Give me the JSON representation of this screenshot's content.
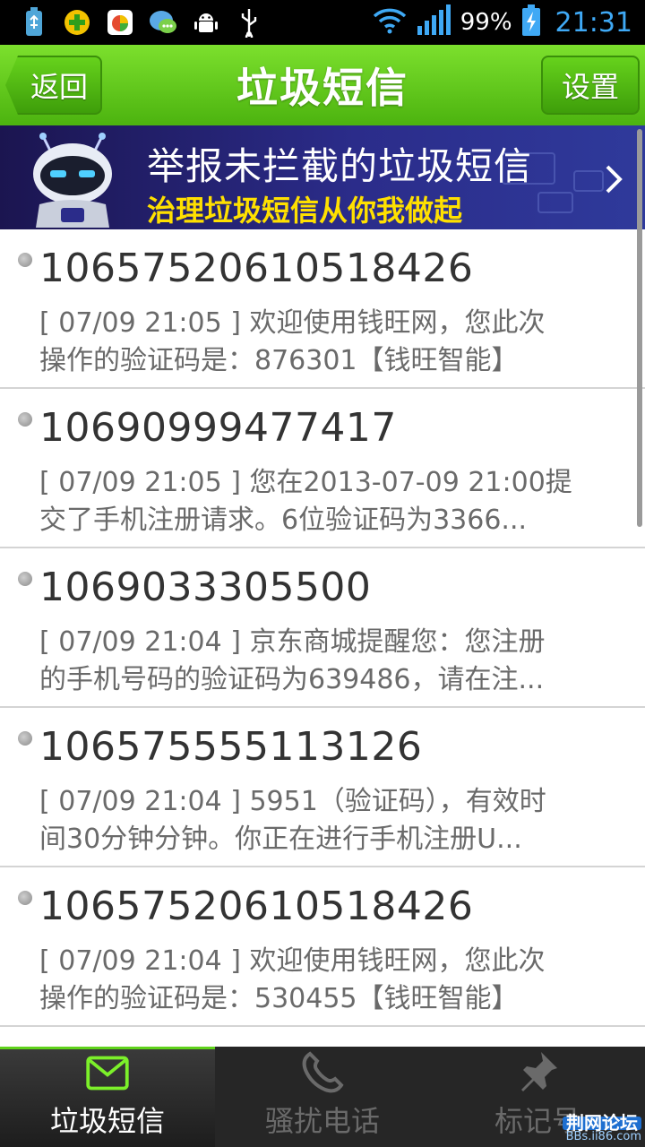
{
  "status_bar": {
    "battery_text": "99%",
    "time": "21:31",
    "icons": [
      "usb-battery-icon",
      "360-security-icon",
      "app-store-icon",
      "chat-qq-icon",
      "android-icon",
      "usb-icon",
      "wifi-icon",
      "signal-icon",
      "battery-charging-icon"
    ],
    "time_color": "#3fa9f5"
  },
  "header": {
    "title": "垃圾短信",
    "back_label": "返回",
    "settings_label": "设置",
    "accent": "#5cc51a"
  },
  "banner": {
    "title": "举报未拦截的垃圾短信",
    "subtitle": "治理垃圾短信从你我做起",
    "subtitle_color": "#ffe000"
  },
  "messages": [
    {
      "sender": "10657520610518426",
      "line1": "[ 07/09 21:05 ] 欢迎使用钱旺网，您此次",
      "line2": "操作的验证码是：876301【钱旺智能】"
    },
    {
      "sender": "10690999477417",
      "line1": "[ 07/09 21:05 ] 您在2013-07-09 21:00提",
      "line2": "交了手机注册请求。6位验证码为3366..."
    },
    {
      "sender": "1069033305500",
      "line1": "[ 07/09 21:04 ] 京东商城提醒您：您注册",
      "line2": "的手机号码的验证码为639486，请在注..."
    },
    {
      "sender": "106575555113126",
      "line1": "[ 07/09 21:04 ] 5951（验证码），有效时",
      "line2": "间30分钟分钟。你正在进行手机注册U..."
    },
    {
      "sender": "10657520610518426",
      "line1": "[ 07/09 21:04 ] 欢迎使用钱旺网，您此次",
      "line2": "操作的验证码是：530455【钱旺智能】"
    }
  ],
  "tabs": [
    {
      "label": "垃圾短信",
      "icon": "envelope-icon",
      "active": true
    },
    {
      "label": "骚扰电话",
      "icon": "phone-icon",
      "active": false
    },
    {
      "label": "标记号",
      "icon": "pin-icon",
      "active": false
    }
  ],
  "watermark": {
    "line1": "荆网论坛",
    "line2": "BBs.ii86.com"
  }
}
